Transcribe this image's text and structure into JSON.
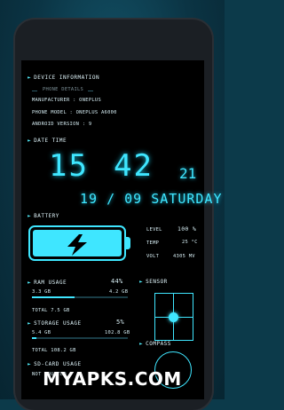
{
  "device": {
    "header": "DEVICE INFORMATION",
    "sub_header": "PHONE DETAILS",
    "manufacturer": "MANUFACTURER : ONEPLUS",
    "model": "PHONE MODEL : ONEPLUS A6000",
    "android": "ANDROID VERSION : 9"
  },
  "datetime": {
    "header": "DATE TIME",
    "hour": "15",
    "minute": "42",
    "second": "21",
    "date": "19 / 09 SATURDAY"
  },
  "battery": {
    "header": "BATTERY",
    "level_label": "LEVEL",
    "level_value": "100 %",
    "level_fraction": 1.0,
    "temp_label": "TEMP",
    "temp_value": "25 °C",
    "volt_label": "VOLT",
    "volt_value": "4305 MV"
  },
  "ram": {
    "header": "RAM USAGE",
    "percent": "44%",
    "used": "3.3 GB",
    "free": "4.2 GB",
    "total": "TOTAL 7.5 GB",
    "fraction": 0.44
  },
  "storage": {
    "header": "STORAGE USAGE",
    "percent": "5%",
    "used": "5.4 GB",
    "free": "102.8 GB",
    "total": "TOTAL 108.2 GB",
    "fraction": 0.05
  },
  "sdcard": {
    "header": "SD-CARD USAGE",
    "status": "NOT MOUNTED"
  },
  "sensor": {
    "header": "SENSOR"
  },
  "compass": {
    "header": "COMPASS"
  },
  "watermark": "MYAPKS.COM",
  "colors": {
    "accent": "#3fe6ff",
    "background": "#000000",
    "frame": "#0c3a4a"
  }
}
